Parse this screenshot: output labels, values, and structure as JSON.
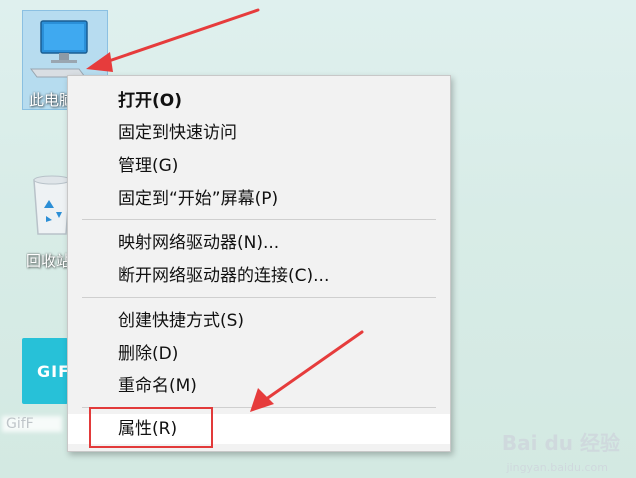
{
  "desktop": {
    "icons": [
      {
        "label": "此电脑"
      },
      {
        "label": "回收站"
      },
      {
        "label": "GIF",
        "caption": "GifF"
      }
    ]
  },
  "context_menu": {
    "items": [
      {
        "label": "打开(O)",
        "bold": true
      },
      {
        "label": "固定到快速访问"
      },
      {
        "label": "管理(G)"
      },
      {
        "label": "固定到“开始”屏幕(P)"
      },
      {
        "label": "映射网络驱动器(N)..."
      },
      {
        "label": "断开网络驱动器的连接(C)..."
      },
      {
        "label": "创建快捷方式(S)"
      },
      {
        "label": "删除(D)"
      },
      {
        "label": "重命名(M)"
      },
      {
        "label": "属性(R)",
        "highlighted": true
      }
    ]
  },
  "annotations": {
    "arrow_color": "#e63c3c",
    "highlight_box_color": "#e23a3a"
  },
  "watermark": {
    "brand": "Bai du 经验",
    "url": "jingyan.baidu.com"
  }
}
